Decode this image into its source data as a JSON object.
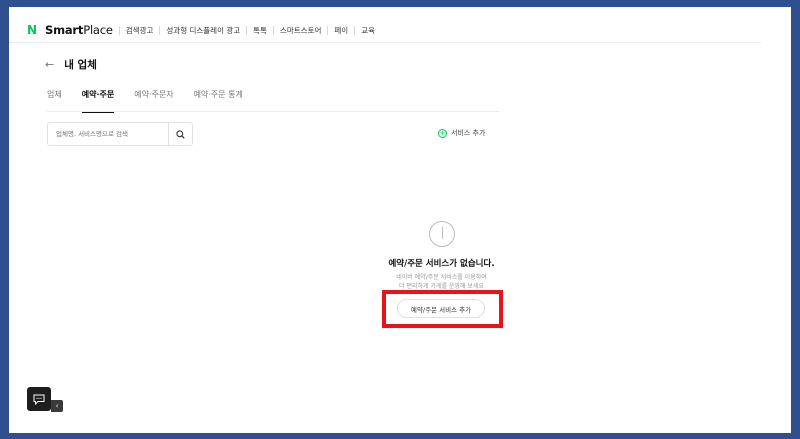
{
  "header": {
    "logo_mark": "N",
    "logo_text_bold": "Smart",
    "logo_text_light": "Place",
    "menu": [
      "검색광고",
      "성과형 디스플레이 광고",
      "톡톡",
      "스마트스토어",
      "페이",
      "교육"
    ]
  },
  "page": {
    "back_icon": "arrow-left-icon",
    "title": "내 업체"
  },
  "tabs": [
    {
      "label": "업체",
      "active": false
    },
    {
      "label": "예약·주문",
      "active": true
    },
    {
      "label": "예약·주문자",
      "active": false
    },
    {
      "label": "예약·주문 통계",
      "active": false
    }
  ],
  "search": {
    "placeholder": "업체명, 서비스명으로 검색"
  },
  "add_service": {
    "label": "서비스 추가"
  },
  "empty_state": {
    "title": "예약/주문 서비스가 없습니다.",
    "desc_line1": "네이버 예약/주문 서비스를 이용하여",
    "desc_line2": "더 편리하게 가게를 운영해 보세요",
    "button_label": "예약/주문 서비스 추가"
  },
  "colors": {
    "brand_green": "#03c75a",
    "frame_blue": "#2f4f8f",
    "highlight_red": "#e8141b"
  }
}
